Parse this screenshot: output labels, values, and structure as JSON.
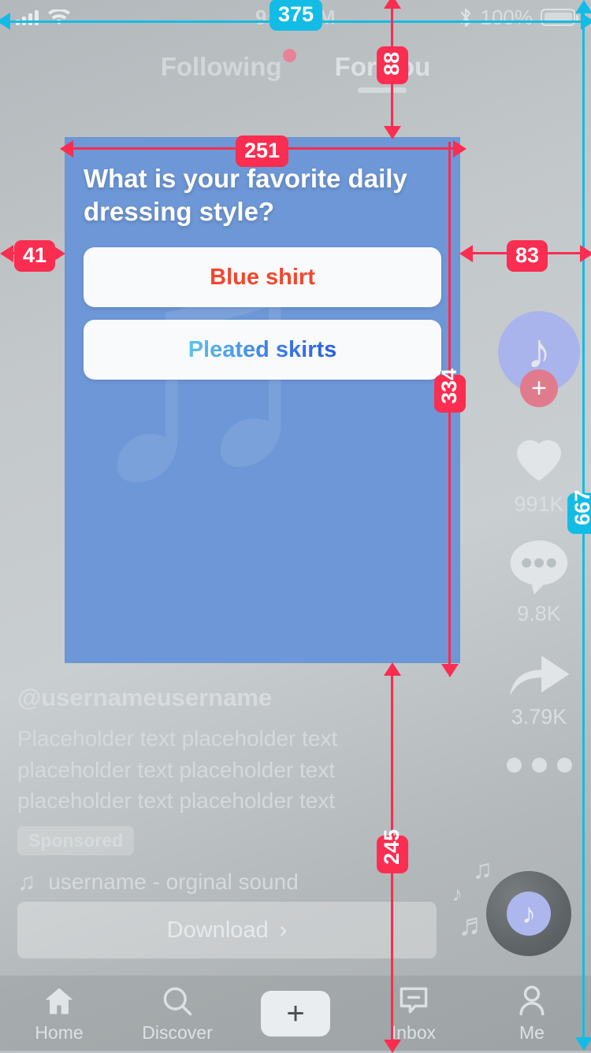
{
  "status_bar": {
    "time": "9:41 AM",
    "battery_percent": "100%",
    "signal_icon": "cellular-signal-icon",
    "wifi_icon": "wifi-icon",
    "bluetooth_icon": "bluetooth-icon",
    "battery_icon": "battery-icon"
  },
  "tabs": {
    "following": "Following",
    "for_you": "For You"
  },
  "poll_card": {
    "question": "What is your favorite daily dressing style?",
    "options": [
      {
        "label": "Blue shirt",
        "color": "#f2472e"
      },
      {
        "label": "Pleated skirts",
        "color": "#3f7fe8"
      }
    ],
    "watermark_icon": "tiktok-note-watermark",
    "background_color": "#6d97d6"
  },
  "action_rail": {
    "avatar_icon": "tiktok-note-avatar-icon",
    "follow_badge": "+",
    "like": {
      "icon": "heart-icon",
      "count": "991K"
    },
    "comment": {
      "icon": "comment-bubble-icon",
      "count": "9.8K"
    },
    "share": {
      "icon": "share-arrow-icon",
      "count": "3.79K"
    },
    "more": {
      "icon": "more-dots-icon"
    }
  },
  "caption": {
    "handle": "@usernameusername",
    "description": "Placeholder text placeholder text placeholder text placeholder text placeholder text placeholder text",
    "sponsored_badge": "Sponsored",
    "sound_icon": "music-note-icon",
    "sound_text": "username - orginal sound"
  },
  "download_cta": {
    "label": "Download",
    "chevron": "›"
  },
  "music_disc": {
    "disc_icon": "spinning-record-icon",
    "inner_icon": "tiktok-note-icon",
    "notes": [
      "♫",
      "♪",
      "♬"
    ]
  },
  "bottom_nav": {
    "items": [
      {
        "label": "Home",
        "icon": "home-icon"
      },
      {
        "label": "Discover",
        "icon": "search-icon"
      },
      {
        "label": "",
        "icon": "create-plus-icon",
        "glyph": "+"
      },
      {
        "label": "Inbox",
        "icon": "inbox-icon"
      },
      {
        "label": "Me",
        "icon": "person-icon"
      }
    ]
  },
  "annotations": {
    "accent_red": "#fb2d50",
    "accent_cyan": "#12bce6",
    "width_total": "375",
    "card_top_offset": "88",
    "card_width": "251",
    "card_left_margin": "41",
    "card_right_margin": "83",
    "card_height": "334",
    "bottom_offset": "245",
    "screen_height": "667"
  }
}
